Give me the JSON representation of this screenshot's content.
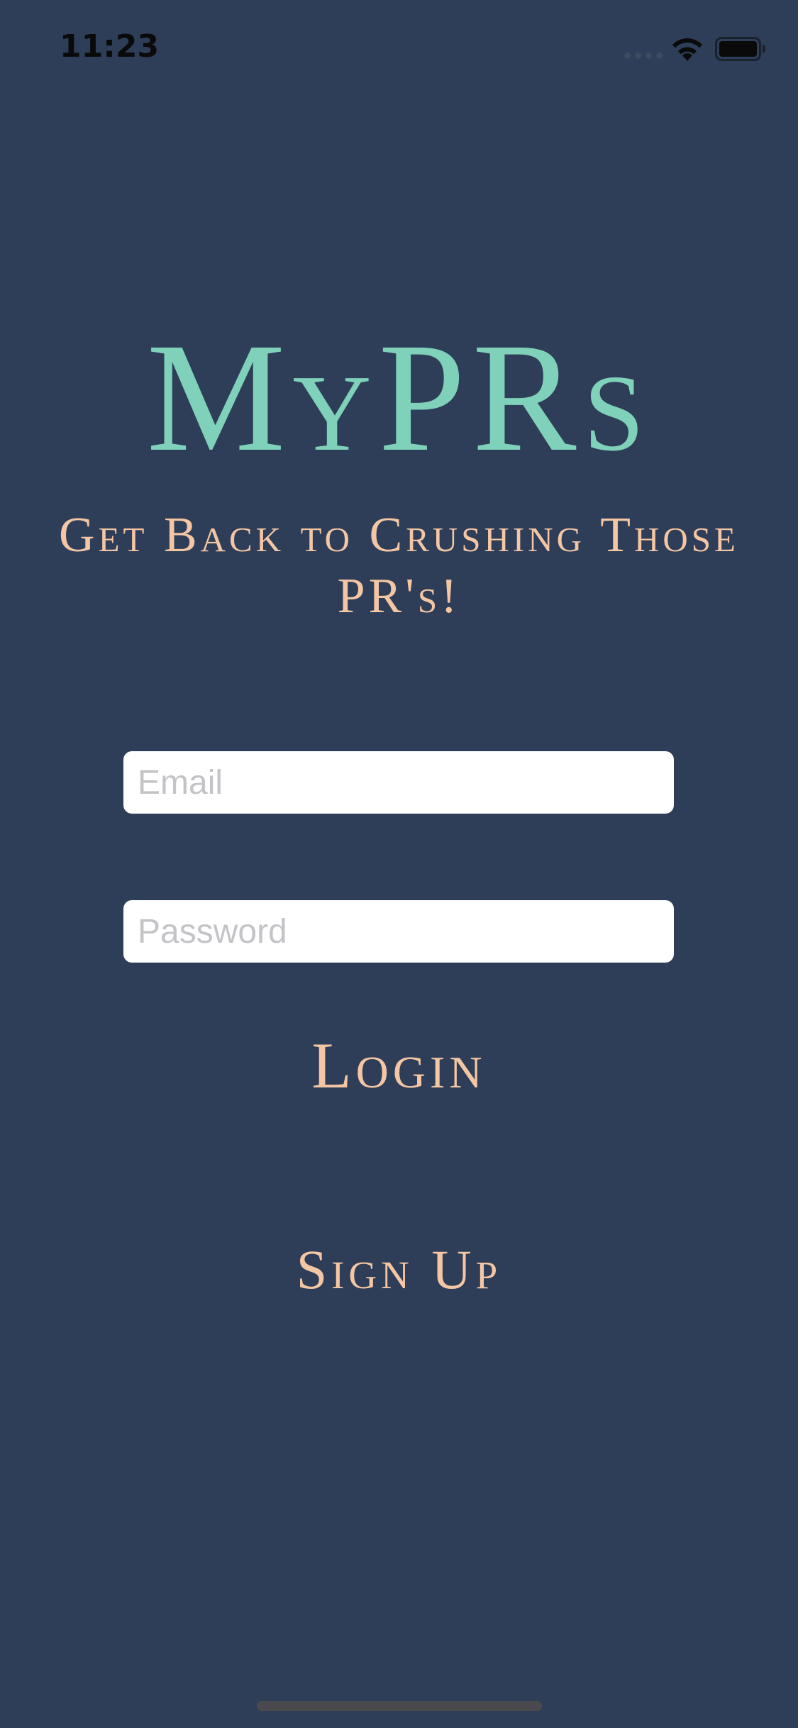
{
  "status_bar": {
    "time": "11:23"
  },
  "app": {
    "title": "MyPRs",
    "tagline": "Get Back to Crushing Those PR's!"
  },
  "form": {
    "email_placeholder": "Email",
    "email_value": "",
    "password_placeholder": "Password",
    "password_value": ""
  },
  "actions": {
    "login_label": "Login",
    "signup_label": "Sign Up"
  },
  "colors": {
    "background": "#2e3e58",
    "title": "#7fd1b9",
    "accent": "#f5c6a3",
    "field_bg": "#ffffff",
    "placeholder": "#c4c4c8"
  },
  "icons": {
    "signal": "cellular-signal-icon",
    "wifi": "wifi-icon",
    "battery": "battery-icon"
  }
}
